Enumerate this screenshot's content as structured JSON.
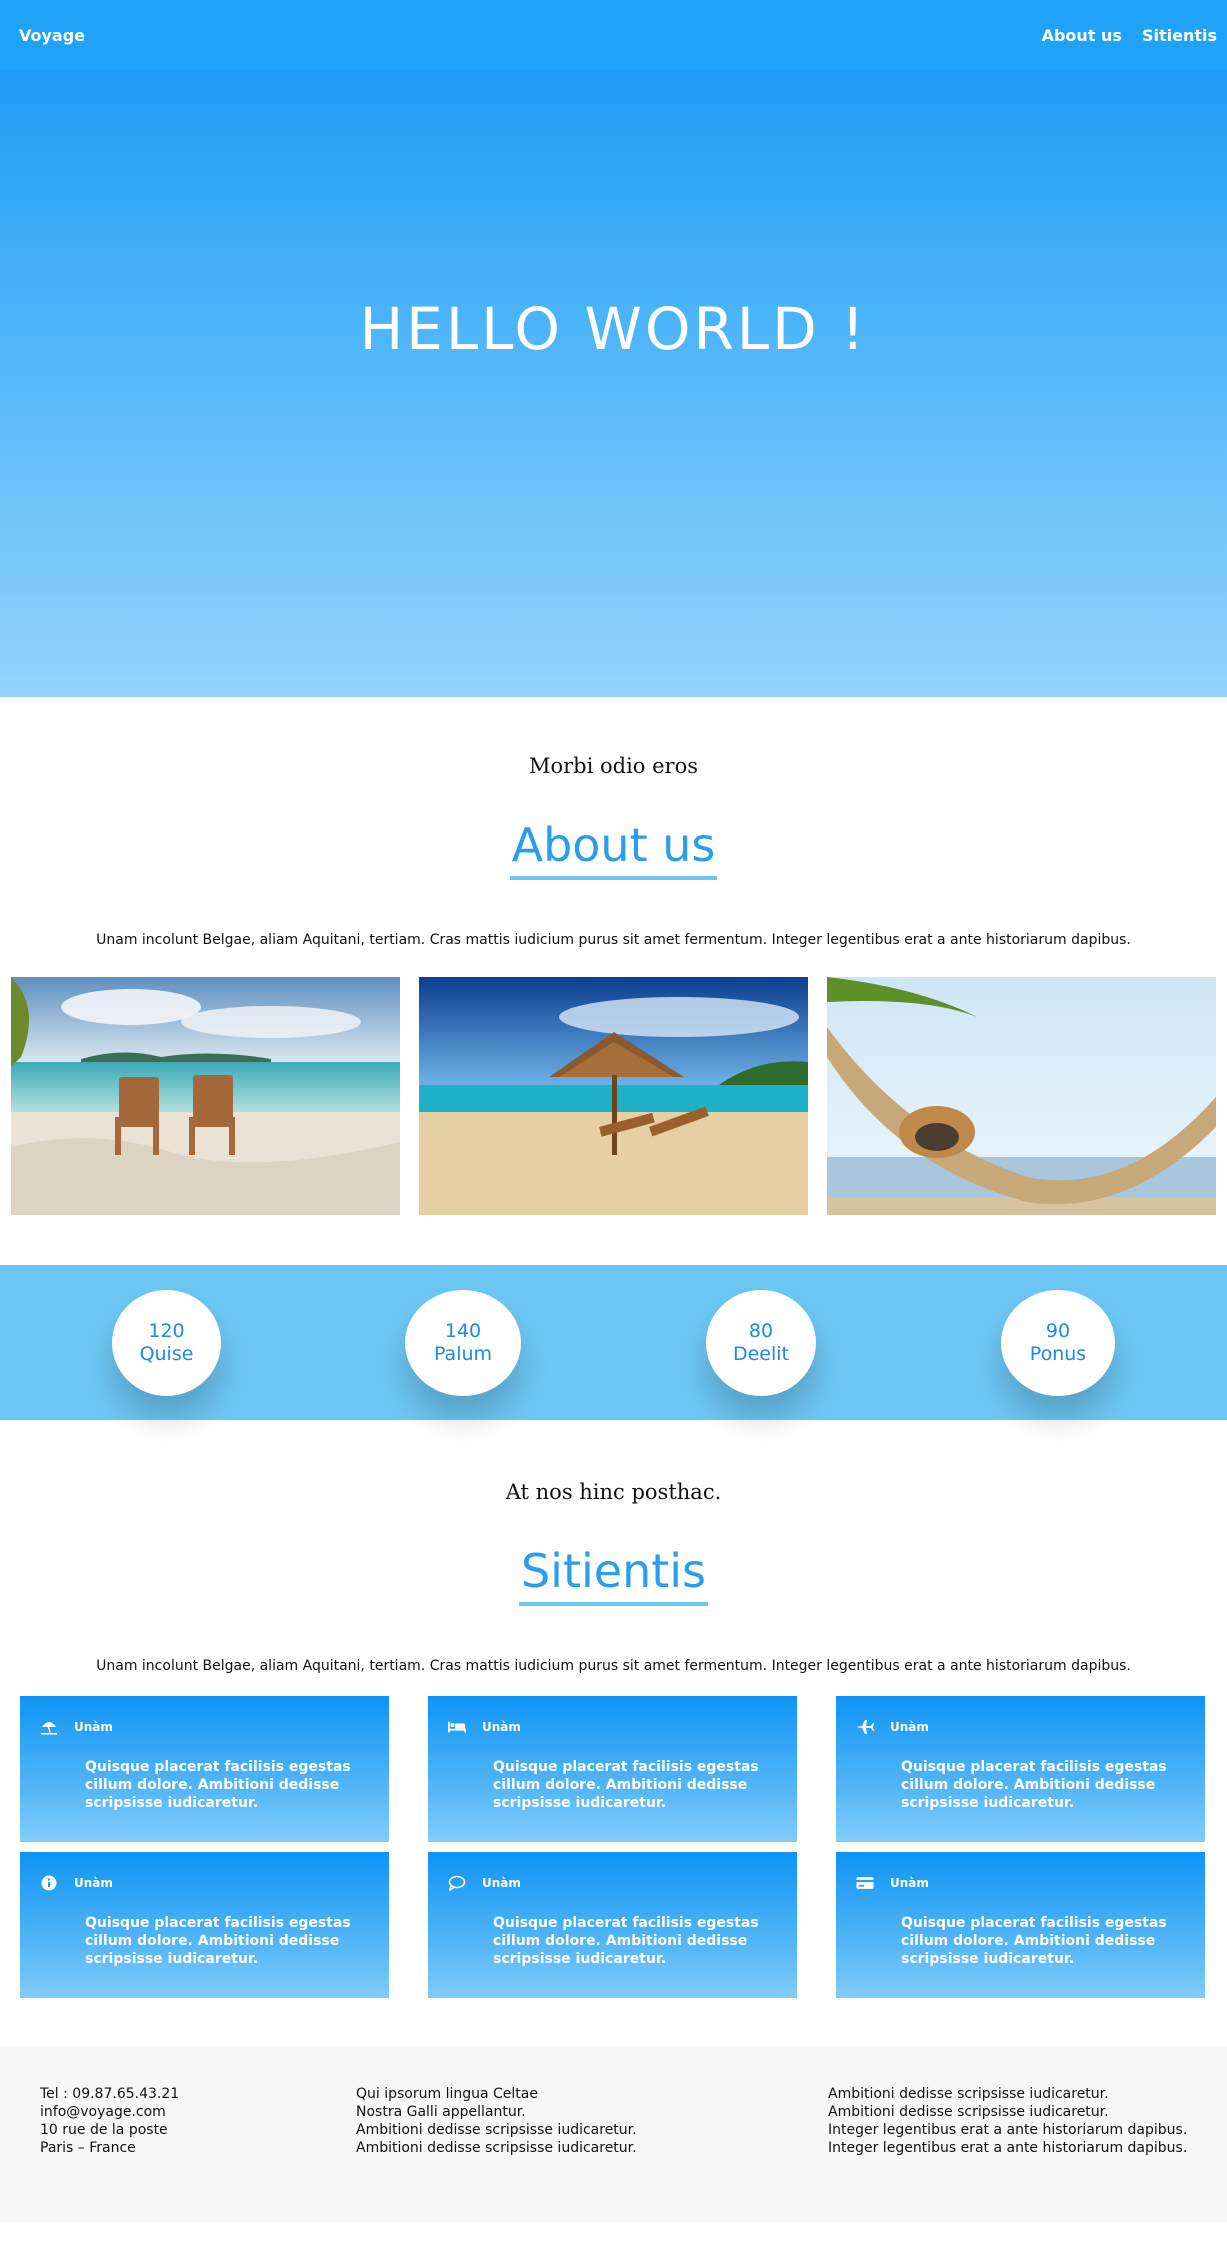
{
  "nav": {
    "brand": "Voyage",
    "links": [
      "About us",
      "Sitientis"
    ]
  },
  "hero": {
    "title": "HELLO WORLD !"
  },
  "about": {
    "kicker": "Morbi odio eros",
    "title": "About us",
    "intro": "Unam incolunt Belgae, aliam Aquitani, tertiam. Cras mattis iudicium purus sit amet fermentum. Integer legentibus erat a ante historiarum dapibus."
  },
  "stats": [
    {
      "value": "120",
      "label": "Quise"
    },
    {
      "value": "140",
      "label": "Palum"
    },
    {
      "value": "80",
      "label": "Deelit"
    },
    {
      "value": "90",
      "label": "Ponus"
    }
  ],
  "services": {
    "kicker": "At nos hinc posthac.",
    "title": "Sitientis",
    "intro": "Unam incolunt Belgae, aliam Aquitani, tertiam. Cras mattis iudicium purus sit amet fermentum. Integer legentibus erat a ante historiarum dapibus.",
    "cards": [
      {
        "icon": "umbrella-beach-icon",
        "label": "Unàm",
        "text": "Quisque placerat facilisis egestas cillum dolore. Ambitioni dedisse scripsisse iudicaretur."
      },
      {
        "icon": "bed-icon",
        "label": "Unàm",
        "text": "Quisque placerat facilisis egestas cillum dolore. Ambitioni dedisse scripsisse iudicaretur."
      },
      {
        "icon": "plane-icon",
        "label": "Unàm",
        "text": "Quisque placerat facilisis egestas cillum dolore. Ambitioni dedisse scripsisse iudicaretur."
      },
      {
        "icon": "info-circle-icon",
        "label": "Unàm",
        "text": "Quisque placerat facilisis egestas cillum dolore. Ambitioni dedisse scripsisse iudicaretur."
      },
      {
        "icon": "speech-bubble-icon",
        "label": "Unàm",
        "text": "Quisque placerat facilisis egestas cillum dolore. Ambitioni dedisse scripsisse iudicaretur."
      },
      {
        "icon": "credit-card-icon",
        "label": "Unàm",
        "text": "Quisque placerat facilisis egestas cillum dolore. Ambitioni dedisse scripsisse iudicaretur."
      }
    ]
  },
  "footer": {
    "contact": [
      "Tel : 09.87.65.43.21",
      "info@voyage.com",
      "10 rue de la poste",
      "Paris – France"
    ],
    "middle": [
      "Qui ipsorum lingua Celtae",
      "Nostra Galli appellantur.",
      "Ambitioni dedisse scripsisse iudicaretur.",
      "Ambitioni dedisse scripsisse iudicaretur."
    ],
    "right": [
      "Ambitioni dedisse scripsisse iudicaretur.",
      "Ambitioni dedisse scripsisse iudicaretur.",
      "Integer legentibus erat a ante historiarum dapibus.",
      "Integer legentibus erat a ante historiarum dapibus."
    ]
  },
  "colors": {
    "nav": "#1ea3f8",
    "accent": "#2c9cec",
    "stats_band": "#6cc6f3",
    "footer_bg": "#f7f7f7"
  }
}
